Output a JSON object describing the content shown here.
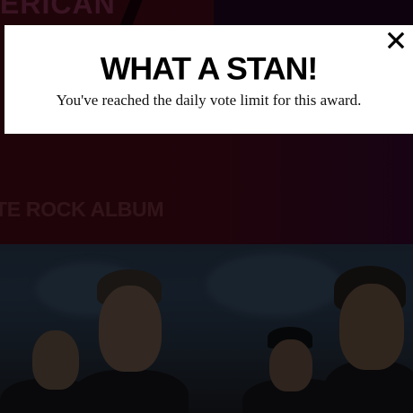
{
  "background": {
    "logo_text": "ERICAN",
    "category_title": "TE ROCK ALBUM"
  },
  "modal": {
    "title": "WHAT A STAN!",
    "message": "You've reached the daily vote limit for this award.",
    "close_icon": "close-icon"
  },
  "colors": {
    "modal_background": "#ffffff",
    "header_background": "#3a0a12",
    "overlay": "rgba(0,0,0,0.45)"
  }
}
